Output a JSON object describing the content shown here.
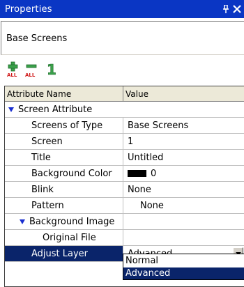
{
  "panel": {
    "title": "Properties"
  },
  "object_name": "Base Screens",
  "toolbar": {
    "expand_all_badge": "ALL",
    "collapse_all_badge": "ALL",
    "one_label": "1"
  },
  "grid": {
    "headers": {
      "name": "Attribute Name",
      "value": "Value"
    },
    "rows": [
      {
        "name": "Screen Attribute",
        "value": ""
      },
      {
        "name": "Screens of Type",
        "value": "Base Screens"
      },
      {
        "name": "Screen",
        "value": "1"
      },
      {
        "name": "Title",
        "value": "Untitled"
      },
      {
        "name": "Background Color",
        "value": "0"
      },
      {
        "name": "Blink",
        "value": "None"
      },
      {
        "name": "Pattern",
        "value": "None"
      },
      {
        "name": "Background Image",
        "value": ""
      },
      {
        "name": "Original File",
        "value": ""
      },
      {
        "name": "Adjust Layer",
        "value": "Advanced"
      }
    ]
  },
  "dropdown": {
    "options": [
      "Normal",
      "Advanced"
    ],
    "selected": "Advanced"
  },
  "colors": {
    "title_bar": "#0a36c4",
    "selection": "#0a246a",
    "expand_triangle": "#1a2fd0",
    "swatch": "#000000"
  },
  "icons": {
    "pin": "pin-icon",
    "close": "close-icon",
    "expand_all": "expand-all-icon",
    "collapse_all": "collapse-all-icon",
    "category_expanded": "expanded-triangle-icon",
    "dropdown": "chevron-down-icon"
  }
}
